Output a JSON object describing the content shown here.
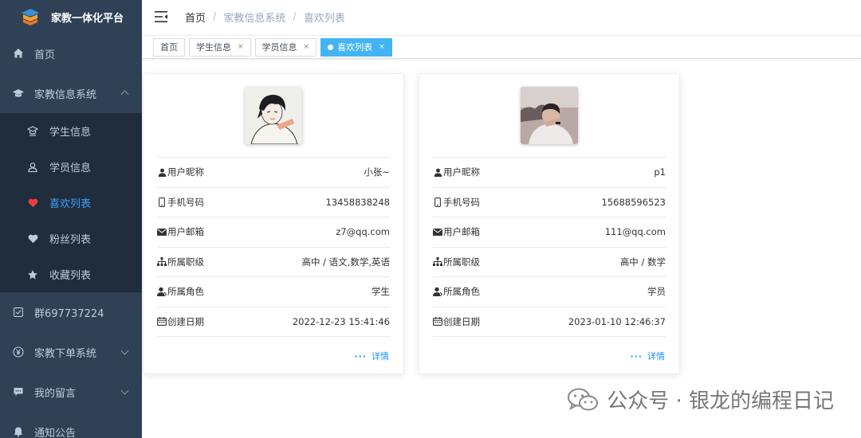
{
  "app": {
    "title": "家教一体化平台"
  },
  "sidebar": {
    "items": [
      {
        "label": "首页",
        "icon": "home-icon"
      },
      {
        "label": "家教信息系统",
        "icon": "graduation-cap-icon",
        "expanded": true
      },
      {
        "label": "群697737224",
        "icon": "checkbox-icon"
      },
      {
        "label": "家教下单系统",
        "icon": "yuan-icon"
      },
      {
        "label": "我的留言",
        "icon": "chat-bubble-icon"
      },
      {
        "label": "通知公告",
        "icon": "bell-icon"
      }
    ],
    "subitems": [
      {
        "label": "学生信息",
        "icon": "student-icon"
      },
      {
        "label": "学员信息",
        "icon": "person-outline-icon"
      },
      {
        "label": "喜欢列表",
        "icon": "heart-icon",
        "active": true
      },
      {
        "label": "粉丝列表",
        "icon": "heart-icon"
      },
      {
        "label": "收藏列表",
        "icon": "star-icon"
      }
    ]
  },
  "breadcrumb": [
    "首页",
    "家教信息系统",
    "喜欢列表"
  ],
  "tags": [
    {
      "label": "首页"
    },
    {
      "label": "学生信息",
      "closable": "×"
    },
    {
      "label": "学员信息",
      "closable": "×"
    },
    {
      "label": "喜欢列表",
      "closable": "×",
      "active": true
    }
  ],
  "card_labels": {
    "nickname": "用户昵称",
    "phone": "手机号码",
    "email": "用户邮箱",
    "level": "所属职级",
    "role": "所属角色",
    "created": "创建日期",
    "detail": "详情"
  },
  "cards": [
    {
      "nickname": "小张~",
      "phone": "13458838248",
      "email": "z7@qq.com",
      "level": "高中 / 语文,数学,英语",
      "role": "学生",
      "created": "2022-12-23 15:41:46"
    },
    {
      "nickname": "p1",
      "phone": "15688596523",
      "email": "111@qq.com",
      "level": "高中 / 数学",
      "role": "学员",
      "created": "2023-01-10 12:46:37"
    }
  ],
  "watermark": {
    "text": "公众号 · 银龙的编程日记"
  },
  "colors": {
    "sidebar_bg": "#304156",
    "submenu_bg": "#1f2d3d",
    "accent": "#409eff",
    "active_tag": "#42b4f4",
    "detail_link": "#1890ff"
  }
}
